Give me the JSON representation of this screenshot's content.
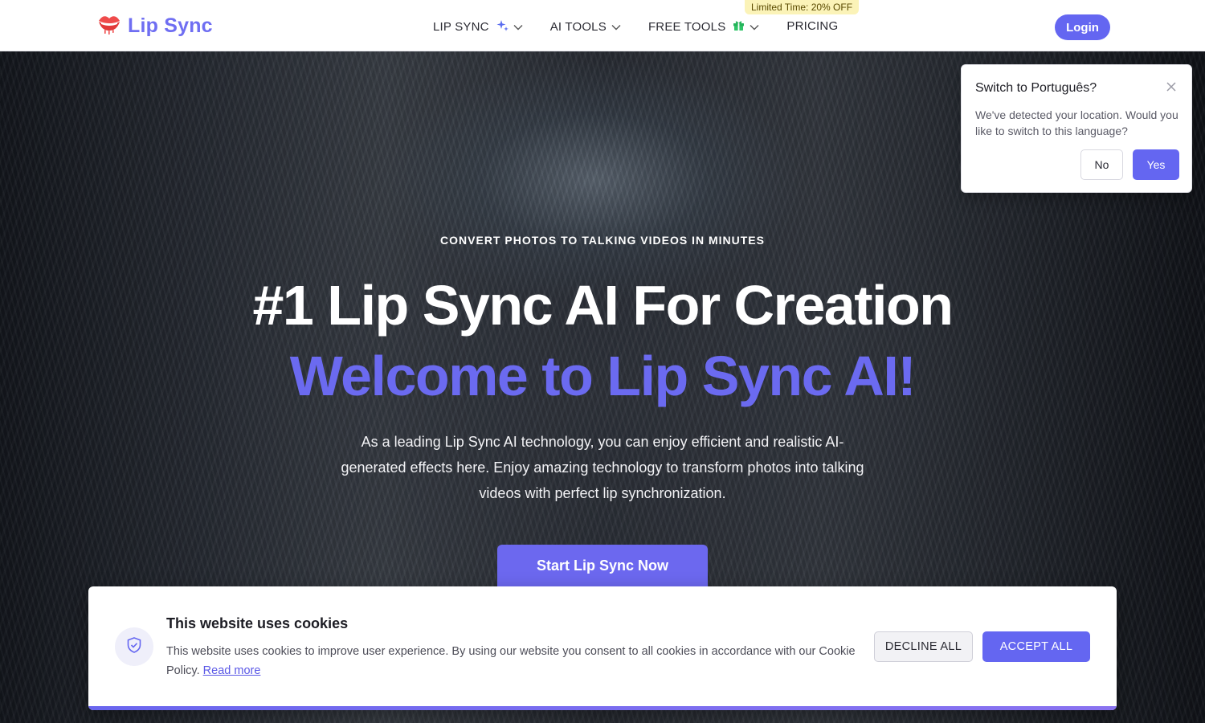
{
  "header": {
    "logo_text": "Lip Sync",
    "nav": [
      {
        "label": "LIP SYNC"
      },
      {
        "label": "AI TOOLS"
      },
      {
        "label": "FREE TOOLS"
      },
      {
        "label": "PRICING"
      }
    ],
    "promo_badge": "Limited Time: 20% OFF",
    "login_label": "Login"
  },
  "hero": {
    "eyebrow": "CONVERT PHOTOS TO TALKING VIDEOS IN MINUTES",
    "title": "#1 Lip Sync AI For Creation",
    "title_accent": "Welcome to Lip Sync AI!",
    "description": "As a leading Lip Sync AI technology, you can enjoy efficient and realistic AI-generated effects here. Enjoy amazing technology to transform photos into talking videos with perfect lip synchronization.",
    "cta_label": "Start Lip Sync Now"
  },
  "language_popup": {
    "title": "Switch to Português?",
    "text": "We've detected your location. Would you like to switch to this language?",
    "no_label": "No",
    "yes_label": "Yes"
  },
  "cookie_banner": {
    "title": "This website uses cookies",
    "text": "This website uses cookies to improve user experience. By using our website you consent to all cookies in accordance with our Cookie Policy.",
    "read_more": "Read more",
    "decline_label": "DECLINE ALL",
    "accept_label": "ACCEPT ALL"
  },
  "colors": {
    "accent": "#6466f1",
    "accent_text": "#6b6af0",
    "promo_bg": "#fbf3b8"
  },
  "icons": [
    "lips-icon",
    "sparkle-icon",
    "chevron-down-icon",
    "gift-icon",
    "close-icon",
    "shield-check-icon"
  ]
}
